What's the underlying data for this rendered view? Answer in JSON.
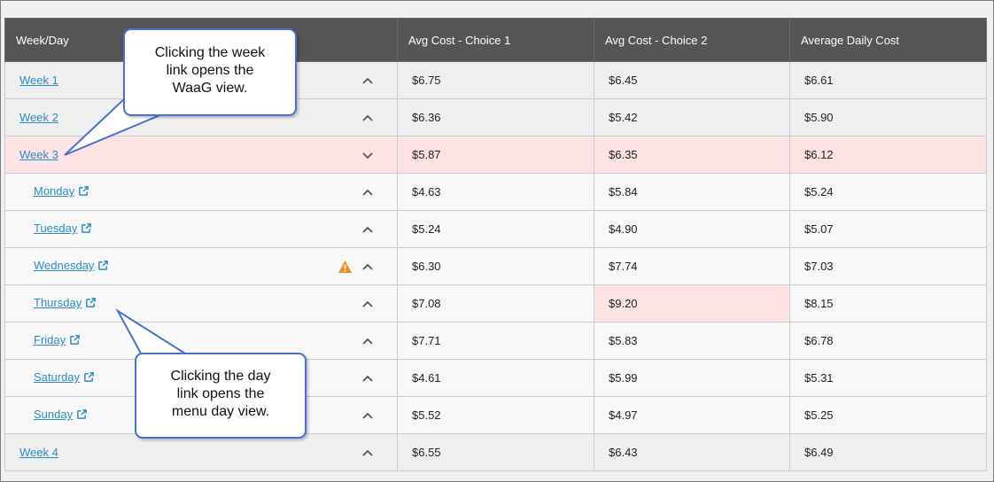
{
  "table": {
    "headers": [
      "Week/Day",
      "Avg Cost - Choice 1",
      "Avg Cost - Choice 2",
      "Average Daily Cost"
    ],
    "rows": [
      {
        "name": "Week 1",
        "type": "week",
        "c1": "$6.75",
        "c2": "$6.45",
        "avg": "$6.61",
        "chevron": "up"
      },
      {
        "name": "Week 2",
        "type": "week",
        "c1": "$6.36",
        "c2": "$5.42",
        "avg": "$5.90",
        "chevron": "up"
      },
      {
        "name": "Week 3",
        "type": "week",
        "c1": "$5.87",
        "c2": "$6.35",
        "avg": "$6.12",
        "chevron": "down",
        "highlight": true
      },
      {
        "name": "Monday",
        "type": "day",
        "c1": "$4.63",
        "c2": "$5.84",
        "avg": "$5.24",
        "chevron": "up"
      },
      {
        "name": "Tuesday",
        "type": "day",
        "c1": "$5.24",
        "c2": "$4.90",
        "avg": "$5.07",
        "chevron": "up"
      },
      {
        "name": "Wednesday",
        "type": "day",
        "c1": "$6.30",
        "c2": "$7.74",
        "avg": "$7.03",
        "chevron": "up",
        "warning": true
      },
      {
        "name": "Thursday",
        "type": "day",
        "c1": "$7.08",
        "c2": "$9.20",
        "avg": "$8.15",
        "chevron": "up",
        "c2_highlight": true
      },
      {
        "name": "Friday",
        "type": "day",
        "c1": "$7.71",
        "c2": "$5.83",
        "avg": "$6.78",
        "chevron": "up"
      },
      {
        "name": "Saturday",
        "type": "day",
        "c1": "$4.61",
        "c2": "$5.99",
        "avg": "$5.31",
        "chevron": "up"
      },
      {
        "name": "Sunday",
        "type": "day",
        "c1": "$5.52",
        "c2": "$4.97",
        "avg": "$5.25",
        "chevron": "up"
      },
      {
        "name": "Week 4",
        "type": "week",
        "c1": "$6.55",
        "c2": "$6.43",
        "avg": "$6.49",
        "chevron": "up"
      }
    ]
  },
  "callouts": {
    "week": [
      "Clicking the week",
      "link opens the",
      "WaaG view."
    ],
    "day": [
      "Clicking the day",
      "link opens the",
      "menu day view."
    ]
  },
  "icons": {
    "external": "external-link-icon",
    "chevron": "chevron-icon",
    "warning": "warning-icon"
  },
  "colors": {
    "header_bg": "#555555",
    "link": "#2a8cc4",
    "highlight": "#fde3e3",
    "warning": "#f08c1e",
    "callout_border": "#4a6fd6"
  }
}
